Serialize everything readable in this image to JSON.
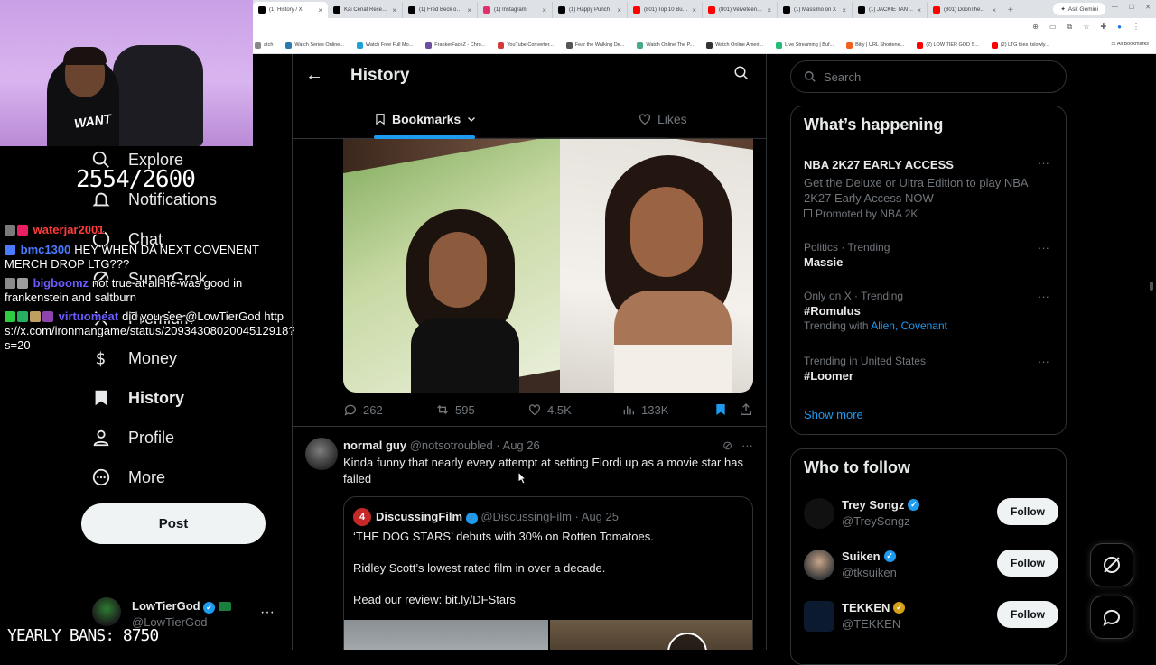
{
  "browser": {
    "tabs": [
      {
        "label": "(1) History / X",
        "active": true,
        "color": "#000000"
      },
      {
        "label": "Kai Cenat Receiv...",
        "color": "#000000"
      },
      {
        "label": "(1) Fred Beck on X",
        "color": "#000000"
      },
      {
        "label": "(1) Instagram",
        "color": "#e1306c"
      },
      {
        "label": "(1) Happy Punch",
        "color": "#000000"
      },
      {
        "label": "(801) Top 10 Bull...",
        "color": "#ff0000"
      },
      {
        "label": "(801) Velveteen S...",
        "color": "#ff0000"
      },
      {
        "label": "(1) Massimo on X",
        "color": "#000000"
      },
      {
        "label": "(1) JACKIE TAN on",
        "color": "#000000"
      },
      {
        "label": "(801) DoonThe...",
        "color": "#ff0000"
      }
    ],
    "new_tab": "+",
    "gemini": "Ask Gemini",
    "bookmarks": [
      {
        "label": "atch",
        "color": "#888888"
      },
      {
        "label": "Watch Series Online...",
        "color": "#2a7ab0"
      },
      {
        "label": "Watch Free Full Mo...",
        "color": "#1aa1d6"
      },
      {
        "label": "FrankerFaceZ - Chro...",
        "color": "#6b4f9e"
      },
      {
        "label": "YouTube Converter...",
        "color": "#d33a3a"
      },
      {
        "label": "Fear the Walking De...",
        "color": "#555555"
      },
      {
        "label": "Watch Online The P...",
        "color": "#4a8"
      },
      {
        "label": "Watch Online Ameri...",
        "color": "#333"
      },
      {
        "label": "Live Streaming | Buf...",
        "color": "#2b7"
      },
      {
        "label": "Bitly | URL Shortene...",
        "color": "#ee6123"
      },
      {
        "label": "(2) LOW TIER GOD S...",
        "color": "#ff0000"
      },
      {
        "label": "(2) LTG tries itslowly...",
        "color": "#ff0000"
      }
    ],
    "all_bookmarks": "All Bookmarks"
  },
  "webcam": {
    "shirt_text": "WANT"
  },
  "overlay": {
    "counter": "2554/2600",
    "bans_label": "YEARLY BANS: 8750",
    "chat": [
      {
        "user": "waterjar2001",
        "user_color": "#ff3b3b",
        "message": ""
      },
      {
        "user": "bmc1300",
        "user_color": "#4a7bff",
        "message": "HEY WHEN DA NEXT COVENENT MERCH DROP LTG???"
      },
      {
        "user": "bigboomz",
        "user_color": "#6a5cff",
        "message": "not true at all he was good in frankenstein and saltburn"
      },
      {
        "user": "virtuomeat",
        "user_color": "#6a5cff",
        "message": "did you see @LowTierGod https://x.com/ironmangame/status/2093430802004512918?s=20"
      }
    ]
  },
  "nav": {
    "items": [
      {
        "label": "Explore",
        "icon": "search-icon"
      },
      {
        "label": "Notifications",
        "icon": "bell-icon"
      },
      {
        "label": "Chat",
        "icon": "chat-icon"
      },
      {
        "label": "SuperGrok",
        "icon": "grok-icon"
      },
      {
        "label": "Premium",
        "icon": "x-icon"
      },
      {
        "label": "Money",
        "icon": "dollar-icon"
      },
      {
        "label": "History",
        "icon": "bookmark-icon",
        "active": true
      },
      {
        "label": "Profile",
        "icon": "person-icon"
      },
      {
        "label": "More",
        "icon": "more-icon"
      }
    ],
    "post_label": "Post",
    "account": {
      "name": "LowTierGod",
      "handle": "@LowTierGod"
    }
  },
  "header": {
    "title": "History",
    "tab_bookmarks": "Bookmarks",
    "tab_likes": "Likes"
  },
  "tweet1": {
    "replies": "262",
    "retweets": "595",
    "likes": "4.5K",
    "views": "133K"
  },
  "tweet2": {
    "name": "normal guy",
    "handle": "@notsotroubled",
    "date": "Aug 26",
    "text": "Kinda funny that nearly every attempt at setting Elordi up as a movie star has failed",
    "quote": {
      "logo": "4",
      "name": "DiscussingFilm",
      "handle": "@DiscussingFilm",
      "date": "Aug 25",
      "line1": "‘THE DOG STARS’ debuts with 30% on Rotten Tomatoes.",
      "line2": "Ridley Scott’s lowest rated film in over a decade.",
      "line3": "Read our review: bit.ly/DFStars"
    }
  },
  "right": {
    "search_placeholder": "Search",
    "happening_title": "What’s happening",
    "trends": [
      {
        "context": "",
        "title": "NBA 2K27 EARLY ACCESS",
        "sub": "Get the Deluxe or Ultra Edition to play NBA 2K27 Early Access NOW",
        "promo": "Promoted by NBA 2K"
      },
      {
        "context": "Politics · Trending",
        "title": "Massie",
        "sub": ""
      },
      {
        "context": "Only on X · Trending",
        "title": "#Romulus",
        "sub": "Trending with",
        "links": "Alien, Covenant"
      },
      {
        "context": "Trending in United States",
        "title": "#Loomer",
        "sub": ""
      }
    ],
    "show_more": "Show more",
    "wtf_title": "Who to follow",
    "follow": [
      {
        "name": "Trey Songz",
        "handle": "@TreySongz",
        "badge_color": "#1d9bf0"
      },
      {
        "name": "Suiken",
        "handle": "@tksuiken",
        "badge_color": "#1d9bf0"
      },
      {
        "name": "TEKKEN",
        "handle": "@TEKKEN",
        "badge_color": "#d4a017"
      }
    ],
    "follow_label": "Follow"
  },
  "colors": {
    "accent": "#1d9bf0",
    "background": "#000000",
    "text": "#e7e9ea",
    "muted": "#71767b"
  }
}
